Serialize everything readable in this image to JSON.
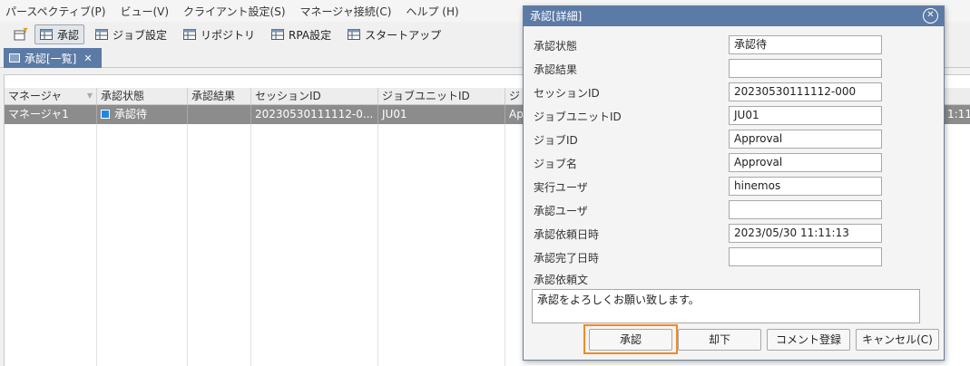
{
  "menu": [
    "パースペクティブ(P)",
    "ビュー(V)",
    "クライアント設定(S)",
    "マネージャ接続(C)",
    "ヘルプ (H)"
  ],
  "toolbar": {
    "buttons": [
      "承認",
      "ジョブ設定",
      "リポジトリ",
      "RPA設定",
      "スタートアップ"
    ],
    "active": "承認"
  },
  "view_tab": {
    "label": "承認[一覧]",
    "close": "✕"
  },
  "list": {
    "columns": [
      "マネージャ",
      "承認状態",
      "承認結果",
      "セッションID",
      "ジョブユニットID",
      "ジ"
    ],
    "rows": [
      {
        "manager": "マネージャ1",
        "status": "承認待",
        "result": "",
        "session": "20230530111112-0...",
        "unit": "JU01",
        "job": "Ap",
        "tail": "1:11"
      }
    ]
  },
  "dialog": {
    "title": "承認[詳細]",
    "fields": [
      {
        "label": "承認状態",
        "value": "承認待"
      },
      {
        "label": "承認結果",
        "value": ""
      },
      {
        "label": "セッションID",
        "value": "20230530111112-000"
      },
      {
        "label": "ジョブユニットID",
        "value": "JU01"
      },
      {
        "label": "ジョブID",
        "value": "Approval"
      },
      {
        "label": "ジョブ名",
        "value": "Approval"
      },
      {
        "label": "実行ユーザ",
        "value": "hinemos"
      },
      {
        "label": "承認ユーザ",
        "value": ""
      },
      {
        "label": "承認依頼日時",
        "value": "2023/05/30 11:11:13"
      },
      {
        "label": "承認完了日時",
        "value": ""
      }
    ],
    "request_label": "承認依頼文",
    "request_text": "承認をよろしくお願い致します。",
    "buttons": {
      "approve": "承認",
      "reject": "却下",
      "comment": "コメント登録",
      "cancel": "キャンセル(C)"
    }
  },
  "colors": {
    "accent": "#5b7aa6",
    "focus": "#f08a24",
    "status": "#1e88e5"
  },
  "icons": [
    "perspective-icon",
    "table-icon",
    "close-icon",
    "close-circle-icon",
    "status-square-icon"
  ]
}
